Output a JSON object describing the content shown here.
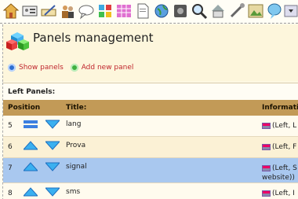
{
  "page": {
    "title": "Panels management"
  },
  "actions": {
    "show_panels": "Show panels",
    "add_new_panel": "Add new panel"
  },
  "section": {
    "label": "Left Panels:"
  },
  "table": {
    "headers": {
      "position": "Position",
      "title": "Title:",
      "information": "Informati"
    },
    "rows": [
      {
        "position": "5",
        "title": "lang",
        "info": "(Left, L"
      },
      {
        "position": "6",
        "title": "Prova",
        "info": "(Left, F"
      },
      {
        "position": "7",
        "title": "signal",
        "info": "(Left, S",
        "info_extra": "website))"
      },
      {
        "position": "8",
        "title": "sms",
        "info": "(Left, I"
      }
    ]
  },
  "colors": {
    "header_bg": "#c29a57",
    "selected_row": "#a9c8ef",
    "link_red": "#c0262d"
  }
}
